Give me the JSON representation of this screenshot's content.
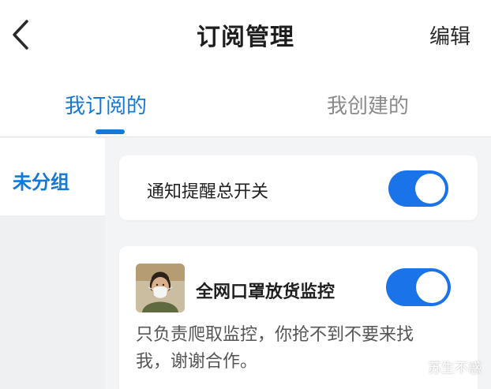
{
  "header": {
    "title": "订阅管理",
    "edit_label": "编辑"
  },
  "tabs": [
    {
      "label": "我订阅的",
      "active": true
    },
    {
      "label": "我创建的",
      "active": false
    }
  ],
  "sidebar": {
    "items": [
      {
        "label": "未分组",
        "selected": true
      }
    ]
  },
  "master_switch": {
    "label": "通知提醒总开关",
    "enabled": true
  },
  "subscriptions": [
    {
      "title": "全网口罩放货监控",
      "description": "只负责爬取监控，你抢不到不要来找我，谢谢合作。",
      "enabled": true
    }
  ],
  "watermark": {
    "text": "苏生不惑"
  },
  "colors": {
    "accent": "#1478d6",
    "toggle_on": "#1a73e8",
    "background": "#f3f4f6"
  },
  "icons": {
    "back": "chevron-left-icon",
    "watermark": "wechat-icon"
  }
}
